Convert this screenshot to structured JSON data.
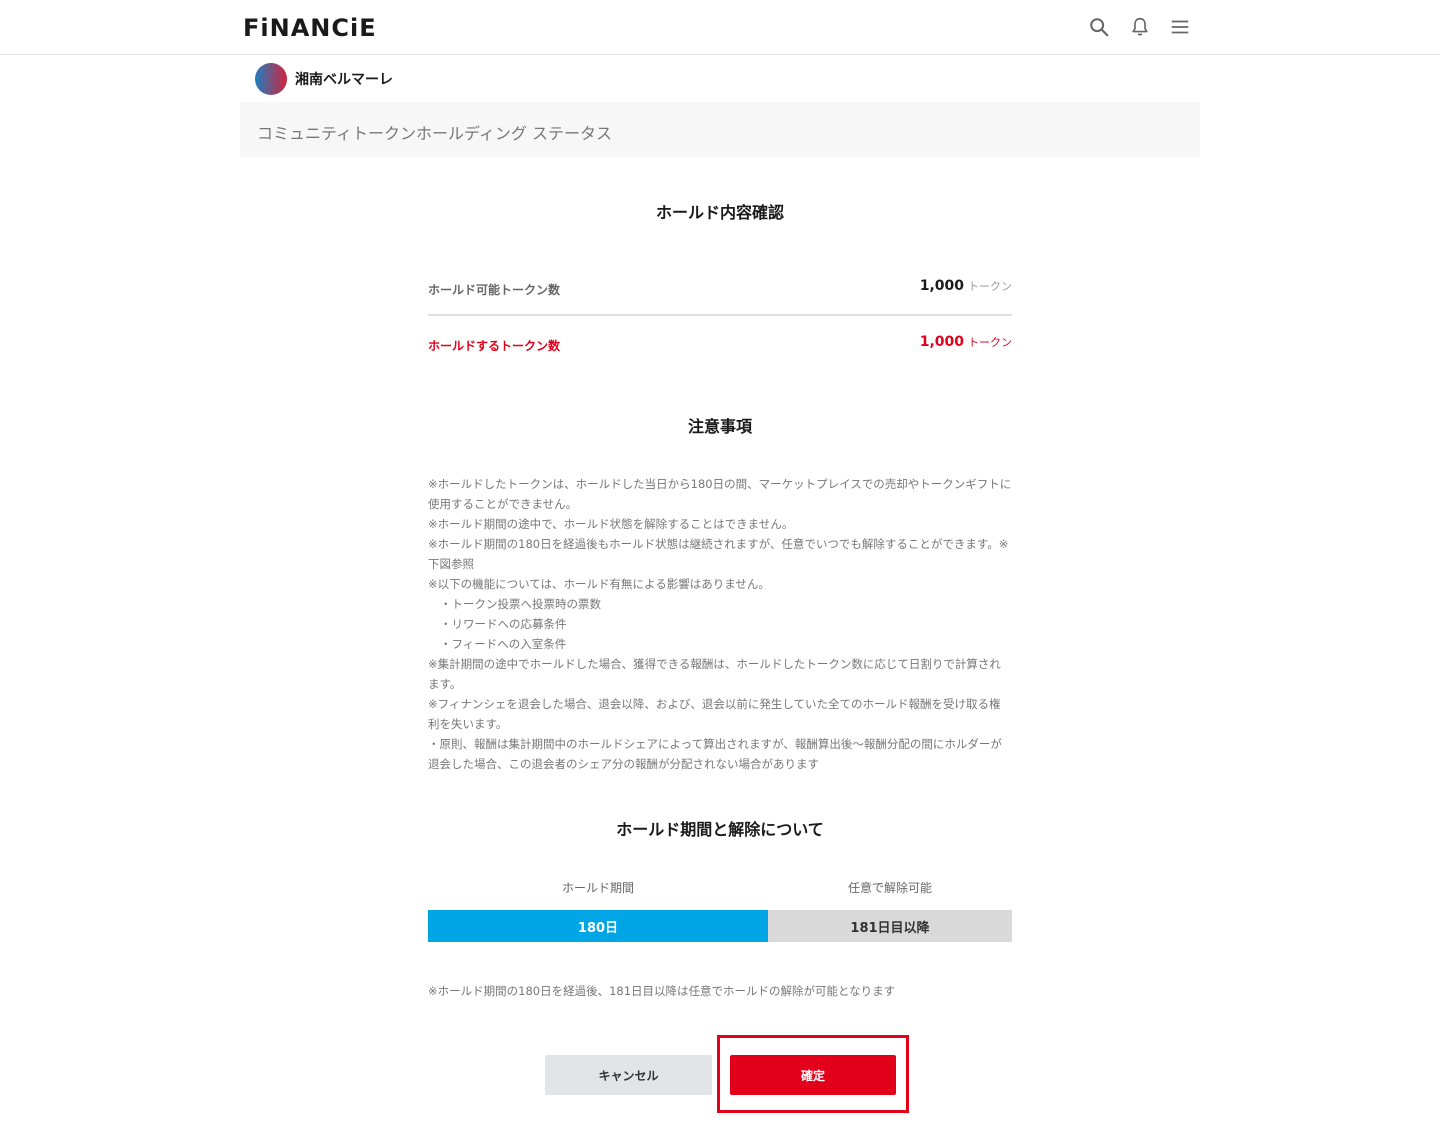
{
  "header": {
    "logo_text": "FiNANCiE",
    "icons": [
      "search-icon",
      "bell-icon",
      "menu-icon"
    ]
  },
  "community": {
    "name": "湘南ベルマーレ"
  },
  "status_bar": {
    "title": "コミュニティトークンホールディング ステータス"
  },
  "confirm_section": {
    "title": "ホールド内容確認",
    "rows": [
      {
        "label": "ホールド可能トークン数",
        "value": "1,000",
        "unit": "トークン"
      },
      {
        "label": "ホールドするトークン数",
        "value": "1,000",
        "unit": "トークン"
      }
    ]
  },
  "notes_section": {
    "title": "注意事項",
    "lines": [
      "※ホールドしたトークンは、ホールドした当日から180日の間、マーケットプレイスでの売却やトークンギフトに使用することができません。",
      "※ホールド期間の途中で、ホールド状態を解除することはできません。",
      "※ホールド期間の180日を経過後もホールド状態は継続されますが、任意でいつでも解除することができます。※下図参照",
      "※以下の機能については、ホールド有無による影響はありません。",
      "・トークン投票へ投票時の票数",
      "・リワードへの応募条件",
      "・フィードへの入室条件",
      "※集計期間の途中でホールドした場合、獲得できる報酬は、ホールドしたトークン数に応じて日割りで計算されます。",
      "※フィナンシェを退会した場合、退会以降、および、退会以前に発生していた全てのホールド報酬を受け取る権利を失います。",
      "・原則、報酬は集計期間中のホールドシェアによって算出されますが、報酬算出後〜報酬分配の間にホルダーが退会した場合、この退会者のシェア分の報酬が分配されない場合があります"
    ]
  },
  "period_section": {
    "title": "ホールド期間と解除について",
    "hold_label": "ホールド期間",
    "free_label": "任意で解除可能",
    "hold_value": "180日",
    "free_value": "181日目以降",
    "note": "※ホールド期間の180日を経過後、181日目以降は任意でホールドの解除が可能となります"
  },
  "buttons": {
    "cancel": "キャンセル",
    "confirm": "確定"
  },
  "colors": {
    "accent_red": "#e3001b",
    "hold_blue": "#00a5e6",
    "free_gray": "#d9d9d9"
  }
}
